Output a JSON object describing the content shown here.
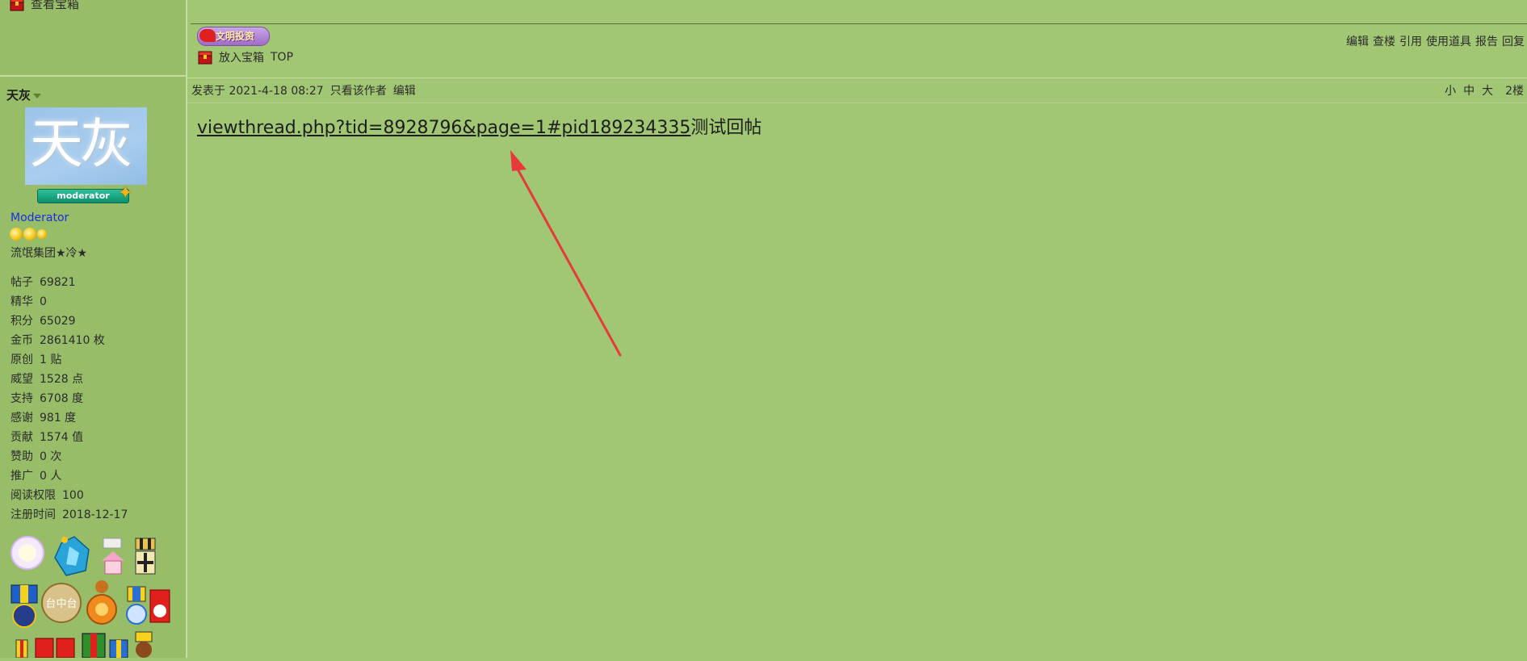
{
  "colors": {
    "page_background": "#a2c774",
    "sidebar_background": "#98bd69",
    "moderator_link": "#1a2ee0",
    "annotation_arrow": "#e63a3a",
    "moderator_badge": "#0c8f6b"
  },
  "sidebar": {
    "view_chest_label": "查看宝箱",
    "view_chest_icon": "treasure-chest-icon",
    "username": "天灰",
    "avatar_text": "天灰",
    "badge_label": "moderator",
    "group_title": "Moderator",
    "custom_title": "流氓集团★冷★",
    "stats": [
      {
        "label": "帖子",
        "value": "69821"
      },
      {
        "label": "精华",
        "value": "0"
      },
      {
        "label": "积分",
        "value": "65029"
      },
      {
        "label": "金币",
        "value": "2861410 枚"
      },
      {
        "label": "原创",
        "value": "1 贴"
      },
      {
        "label": "威望",
        "value": "1528 点"
      },
      {
        "label": "支持",
        "value": "6708 度"
      },
      {
        "label": "感谢",
        "value": "981 度"
      },
      {
        "label": "贡献",
        "value": "1574 值"
      },
      {
        "label": "赞助",
        "value": "0 次"
      },
      {
        "label": "推广",
        "value": "0 人"
      },
      {
        "label": "阅读权限",
        "value": "100"
      },
      {
        "label": "注册时间",
        "value": "2018-12-17"
      }
    ],
    "medal_logo_text": "台中台"
  },
  "post": {
    "ad_banner_text": "文明投资",
    "add_to_chest_label": "放入宝箱",
    "top_label": "TOP",
    "actions": {
      "edit": "编辑",
      "view_floor": "查楼",
      "quote": "引用",
      "use_item": "使用道具",
      "report": "报告",
      "reply": "回复"
    },
    "meta": {
      "posted_at": "发表于 2021-4-18 08:27",
      "only_author": "只看该作者",
      "edit": "编辑",
      "font_small": "小",
      "font_medium": "中",
      "font_large": "大",
      "floor": "2楼"
    },
    "body_link": "viewthread.php?tid=8928796&page=1#pid189234335",
    "body_text": "测试回帖"
  }
}
